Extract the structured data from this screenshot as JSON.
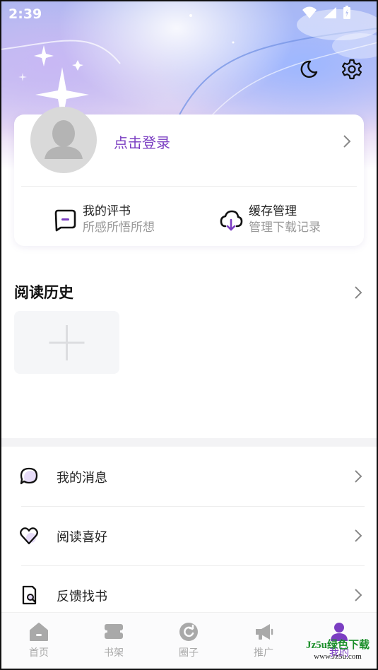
{
  "status_bar": {
    "time": "2:39"
  },
  "header": {
    "moon_icon": "moon-icon",
    "settings_icon": "gear-icon"
  },
  "profile": {
    "login_label": "点击登录"
  },
  "quick_actions": [
    {
      "title": "我的评书",
      "subtitle": "所感所悟所想",
      "icon": "comment-icon"
    },
    {
      "title": "缓存管理",
      "subtitle": "管理下载记录",
      "icon": "cloud-download-icon"
    }
  ],
  "history": {
    "title": "阅读历史"
  },
  "menu": [
    {
      "label": "我的消息",
      "icon": "message-icon"
    },
    {
      "label": "阅读喜好",
      "icon": "heart-icon"
    },
    {
      "label": "反馈找书",
      "icon": "search-book-icon"
    }
  ],
  "tabs": [
    {
      "label": "首页",
      "icon": "home-icon"
    },
    {
      "label": "书架",
      "icon": "bookshelf-icon"
    },
    {
      "label": "圈子",
      "icon": "circle-icon"
    },
    {
      "label": "推广",
      "icon": "megaphone-icon"
    },
    {
      "label": "我的",
      "icon": "user-icon",
      "active": true
    }
  ],
  "watermark": {
    "line1": "Jz5u绿色下载",
    "line2": "www.Jz5u.com"
  },
  "colors": {
    "accent": "#7b3ec2",
    "muted": "#a9a9a9"
  }
}
